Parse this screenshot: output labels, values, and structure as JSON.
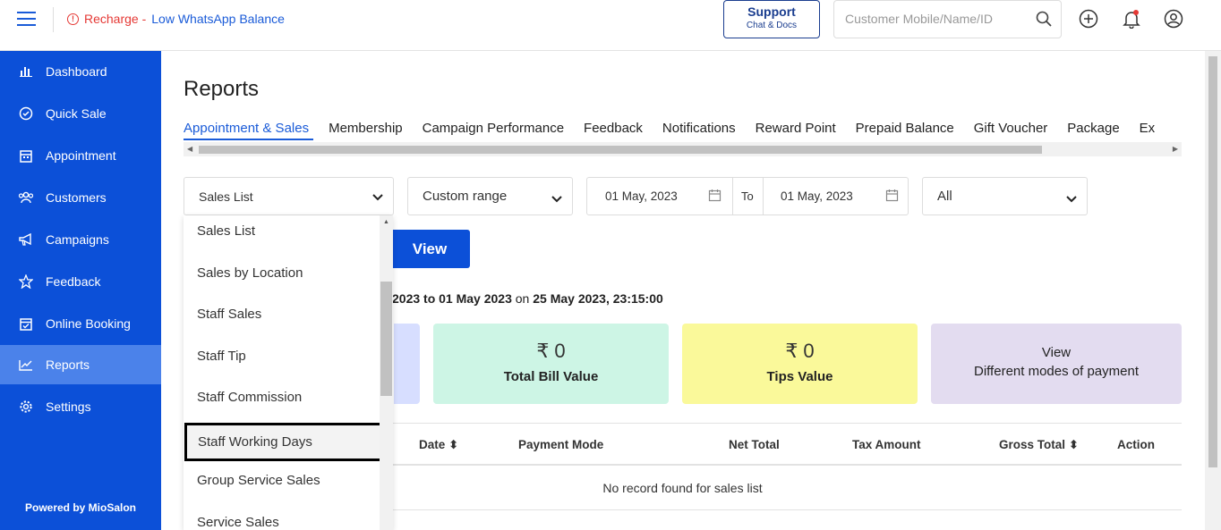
{
  "topbar": {
    "alert_prefix": "Recharge -",
    "alert_text": "Low WhatsApp Balance",
    "support_title": "Support",
    "support_sub": "Chat & Docs",
    "search_placeholder": "Customer Mobile/Name/ID"
  },
  "sidebar": {
    "items": [
      {
        "label": "Dashboard",
        "icon": "bar-chart-icon"
      },
      {
        "label": "Quick Sale",
        "icon": "check-circle-icon"
      },
      {
        "label": "Appointment",
        "icon": "calendar-icon"
      },
      {
        "label": "Customers",
        "icon": "users-icon"
      },
      {
        "label": "Campaigns",
        "icon": "megaphone-icon"
      },
      {
        "label": "Feedback",
        "icon": "star-icon"
      },
      {
        "label": "Online Booking",
        "icon": "calendar-check-icon"
      },
      {
        "label": "Reports",
        "icon": "trend-chart-icon"
      },
      {
        "label": "Settings",
        "icon": "gear-icon"
      }
    ],
    "active": "Reports",
    "powered_by": "Powered by MioSalon"
  },
  "main": {
    "title": "Reports",
    "tabs": [
      "Appointment & Sales",
      "Membership",
      "Campaign Performance",
      "Feedback",
      "Notifications",
      "Reward Point",
      "Prepaid Balance",
      "Gift Voucher",
      "Package",
      "Ex"
    ],
    "active_tab": "Appointment & Sales",
    "filters": {
      "report_type": "Sales List",
      "range": "Custom range",
      "from_date": "01 May, 2023",
      "to_label": "To",
      "to_date": "01 May, 2023",
      "location": "All"
    },
    "view_button": "View",
    "date_range_prefix": "2023 to 01 May 2023",
    "date_range_on": "on",
    "date_range_generated": "25 May 2023, 23:15:00",
    "cards": [
      {
        "value": "₹ 0",
        "label": "Total Bill Value",
        "color": "#cdf5e5"
      },
      {
        "value": "₹ 0",
        "label": "Tips Value",
        "color": "#faf99a"
      }
    ],
    "payment_card": {
      "line1": "View",
      "line2": "Different modes of payment",
      "color": "#e3dcf0"
    },
    "partial_card_color": "#d7deff",
    "table_headers": [
      "Date",
      "Payment Mode",
      "Net Total",
      "Tax Amount",
      "Gross Total",
      "Action"
    ],
    "empty_message": "No record found for sales list"
  },
  "dropdown": {
    "options": [
      "Sales List",
      "Sales by Location",
      "Staff Sales",
      "Staff Tip",
      "Staff Commission",
      "Staff Working Days",
      "Group Service Sales",
      "Service Sales"
    ],
    "highlighted": "Staff Working Days"
  },
  "colors": {
    "brand_blue": "#0c50d8",
    "sidebar_active": "#4b82ea",
    "alert_red": "#e53935"
  }
}
